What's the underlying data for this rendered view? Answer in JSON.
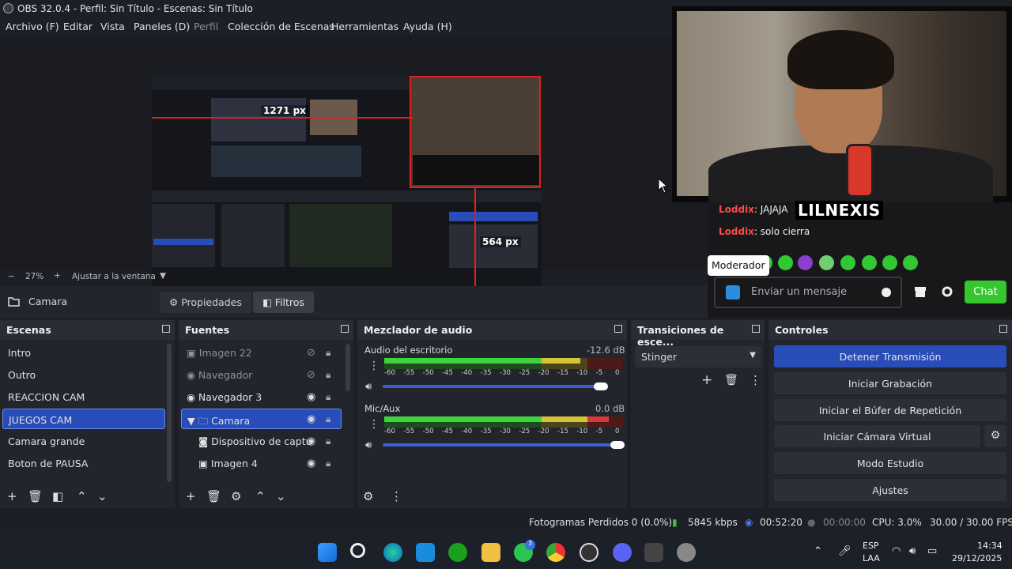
{
  "window": {
    "title": "OBS 32.0.4 - Perfil: Sin Título - Escenas: Sin Título"
  },
  "menu": [
    "Archivo (F)",
    "Editar",
    "Vista",
    "Paneles (D)",
    "Perfil",
    "Colección de Escenas",
    "Herramientas",
    "Ayuda (H)"
  ],
  "preview": {
    "measure_h": "1271 px",
    "measure_v": "564 px"
  },
  "zoom": {
    "minus": "−",
    "value": "27%",
    "plus": "+",
    "fit": "Ajustar a la ventana"
  },
  "source_bar": {
    "name": "Camara",
    "props": "Propiedades",
    "filters": "Filtros"
  },
  "scenes": {
    "title": "Escenas",
    "items": [
      "Intro",
      "Outro",
      "REACCION CAM",
      "JUEGOS CAM",
      "Camara grande",
      "Boton de PAUSA"
    ],
    "selected": 3
  },
  "sources": {
    "title": "Fuentes",
    "items": [
      {
        "name": "Imagen 22",
        "type": "image",
        "visible": false,
        "dim": true
      },
      {
        "name": "Navegador",
        "type": "browser",
        "visible": false,
        "dim": true
      },
      {
        "name": "Navegador 3",
        "type": "browser",
        "visible": true,
        "dim": false
      },
      {
        "name": "Camara",
        "type": "group",
        "visible": true,
        "dim": false
      },
      {
        "name": "Dispositivo de captu",
        "type": "camera",
        "visible": true,
        "dim": false
      },
      {
        "name": "Imagen 4",
        "type": "image",
        "visible": true,
        "dim": false
      }
    ]
  },
  "mixer": {
    "title": "Mezclador de audio",
    "channels": [
      {
        "name": "Audio del escritorio",
        "db": "-12.6 dB",
        "level": 0.82,
        "volume": 0.93
      },
      {
        "name": "Mic/Aux",
        "db": "0.0 dB",
        "level": 0.94,
        "volume": 1.0
      }
    ],
    "ticks": [
      "-60",
      "-55",
      "-50",
      "-45",
      "-40",
      "-35",
      "-30",
      "-25",
      "-20",
      "-15",
      "-10",
      "-5",
      "0"
    ]
  },
  "transitions": {
    "title": "Transiciones de esce...",
    "selected": "Stinger"
  },
  "controls": {
    "title": "Controles",
    "buttons": [
      "Detener Transmisión",
      "Iniciar Grabación",
      "Iniciar el Búfer de Repetición",
      "Iniciar Cámara Virtual",
      "Modo Estudio",
      "Ajustes"
    ]
  },
  "chat": {
    "overlay_name": "LILNEXIS",
    "messages": [
      {
        "user": "Loddix",
        "text": ": JAJAJA"
      },
      {
        "user": "Loddix",
        "text": ": solo cierra"
      }
    ],
    "tooltip": "Moderador",
    "placeholder": "Enviar un mensaje",
    "send": "Chat"
  },
  "status": {
    "dropped": "Fotogramas Perdidos 0 (0.0%)",
    "kbps": "5845 kbps",
    "stream_time": "00:52:20",
    "rec_time": "00:00:00",
    "cpu": "CPU: 3.0%",
    "fps": "30.00 / 30.00 FPS"
  },
  "taskbar": {
    "lang1": "ESP",
    "lang2": "LAA",
    "time": "14:34",
    "date": "29/12/2025",
    "badge": "3"
  },
  "colors": {
    "accent": "#284cb8",
    "red": "#e02020",
    "twitch_green": "#35c72d"
  }
}
